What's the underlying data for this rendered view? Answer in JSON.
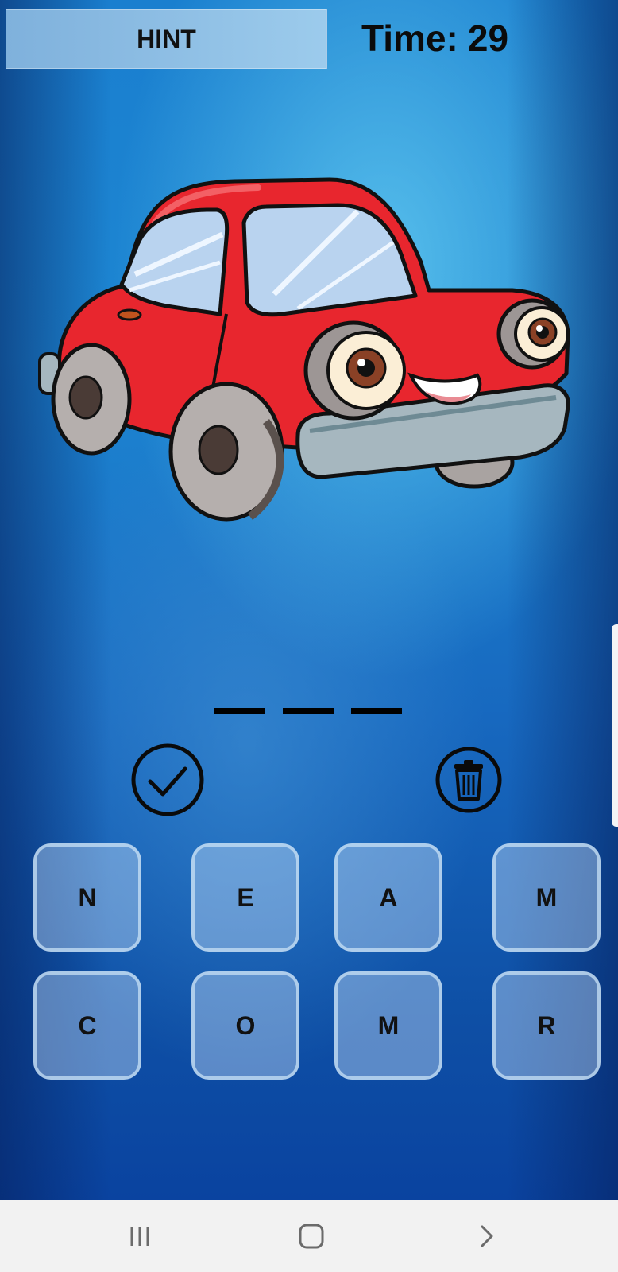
{
  "header": {
    "hint_label": "HINT",
    "time_label": "Time:",
    "time_value": "29"
  },
  "puzzle": {
    "image_icon": "red-cartoon-car",
    "answer_slot_count": 3,
    "answer_slots": [
      "",
      "",
      ""
    ]
  },
  "actions": {
    "submit_icon": "checkmark-circle-icon",
    "delete_icon": "trash-circle-icon"
  },
  "letters": {
    "row1": [
      "N",
      "E",
      "A",
      "M"
    ],
    "row2": [
      "C",
      "O",
      "M",
      "R"
    ]
  },
  "navigation": {
    "recent_icon": "recent-apps-icon",
    "home_icon": "home-icon",
    "back_icon": "back-icon"
  },
  "colors": {
    "car_body": "#e8262e",
    "background_accent": "#1d86d2",
    "tile_fill": "#a9c9ea"
  }
}
